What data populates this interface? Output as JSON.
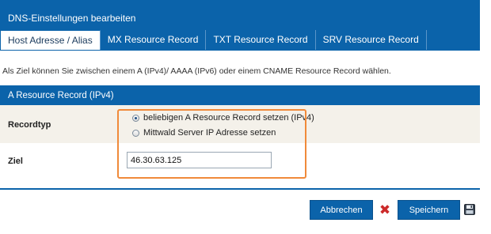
{
  "dialog": {
    "title": "DNS-Einstellungen bearbeiten"
  },
  "tabs": [
    {
      "label": "Host Adresse / Alias",
      "active": true
    },
    {
      "label": "MX Resource Record",
      "active": false
    },
    {
      "label": "TXT Resource Record",
      "active": false
    },
    {
      "label": "SRV Resource Record",
      "active": false
    }
  ],
  "info_text": "Als Ziel können Sie zwischen einem A (IPv4)/ AAAA (IPv6) oder einem CNAME Resource Record wählen.",
  "section": {
    "title": "A Resource Record (IPv4)"
  },
  "recordtyp": {
    "label": "Recordtyp",
    "options": [
      {
        "label": "beliebigen A Resource Record setzen (IPv4)",
        "checked": true
      },
      {
        "label": "Mittwald Server IP Adresse setzen",
        "checked": false
      }
    ]
  },
  "ziel": {
    "label": "Ziel",
    "value": "46.30.63.125"
  },
  "actions": {
    "cancel_label": "Abbrechen",
    "save_label": "Speichern"
  },
  "colors": {
    "primary": "#0b63aa",
    "highlight": "#f08a3a",
    "cancel_icon": "#cc2a2a"
  },
  "icons": {
    "cancel": "close-icon",
    "save": "save-icon"
  }
}
